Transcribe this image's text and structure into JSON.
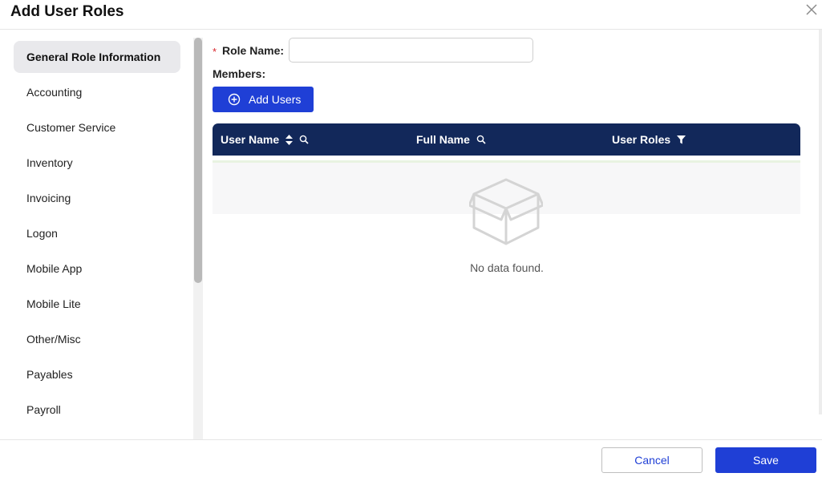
{
  "dialog": {
    "title": "Add User Roles"
  },
  "sidebar": {
    "items": [
      {
        "label": "General Role Information",
        "active": true
      },
      {
        "label": "Accounting"
      },
      {
        "label": "Customer Service"
      },
      {
        "label": "Inventory"
      },
      {
        "label": "Invoicing"
      },
      {
        "label": "Logon"
      },
      {
        "label": "Mobile App"
      },
      {
        "label": "Mobile Lite"
      },
      {
        "label": "Other/Misc"
      },
      {
        "label": "Payables"
      },
      {
        "label": "Payroll"
      }
    ]
  },
  "form": {
    "required_mark": "*",
    "role_name_label": "Role Name:",
    "role_name_value": "",
    "role_name_placeholder": "",
    "members_label": "Members:",
    "add_users_label": "Add Users"
  },
  "table": {
    "columns": [
      {
        "label": "User Name",
        "icons": [
          "sort-icon",
          "search-icon"
        ]
      },
      {
        "label": "Full Name",
        "icons": [
          "search-icon"
        ]
      },
      {
        "label": "User Roles",
        "icons": [
          "filter-icon"
        ]
      }
    ],
    "rows": [],
    "empty_text": "No data found."
  },
  "footer": {
    "cancel_label": "Cancel",
    "save_label": "Save"
  },
  "colors": {
    "primary": "#1f3fd6",
    "table_header": "#12285a",
    "required": "#d9272e"
  }
}
